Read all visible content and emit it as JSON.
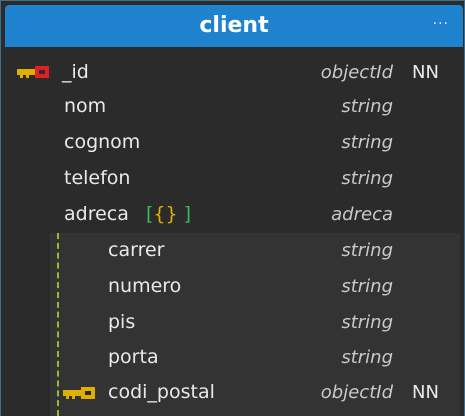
{
  "entity": {
    "title": "client",
    "menu_label": "···"
  },
  "fields": [
    {
      "name": "_id",
      "type": "objectId",
      "nn": "NN",
      "icon": "primary-key-icon"
    },
    {
      "name": "nom",
      "type": "string"
    },
    {
      "name": "cognom",
      "type": "string"
    },
    {
      "name": "telefon",
      "type": "string"
    },
    {
      "name": "adreca",
      "braces": [
        "[",
        "{",
        "}",
        "]"
      ],
      "type": "adreca"
    }
  ],
  "subfields": [
    {
      "name": "carrer",
      "type": "string"
    },
    {
      "name": "numero",
      "type": "string"
    },
    {
      "name": "pis",
      "type": "string"
    },
    {
      "name": "porta",
      "type": "string"
    },
    {
      "name": "codi_postal",
      "type": "objectId",
      "nn": "NN",
      "icon": "foreign-key-icon"
    }
  ],
  "colors": {
    "header": "#1f82cf",
    "primary_key": "#e02020",
    "foreign_key": "#e0b000",
    "nested_line": "#8fbf2f",
    "brackets_square": "#3fb950",
    "brackets_curly": "#d9b300"
  }
}
